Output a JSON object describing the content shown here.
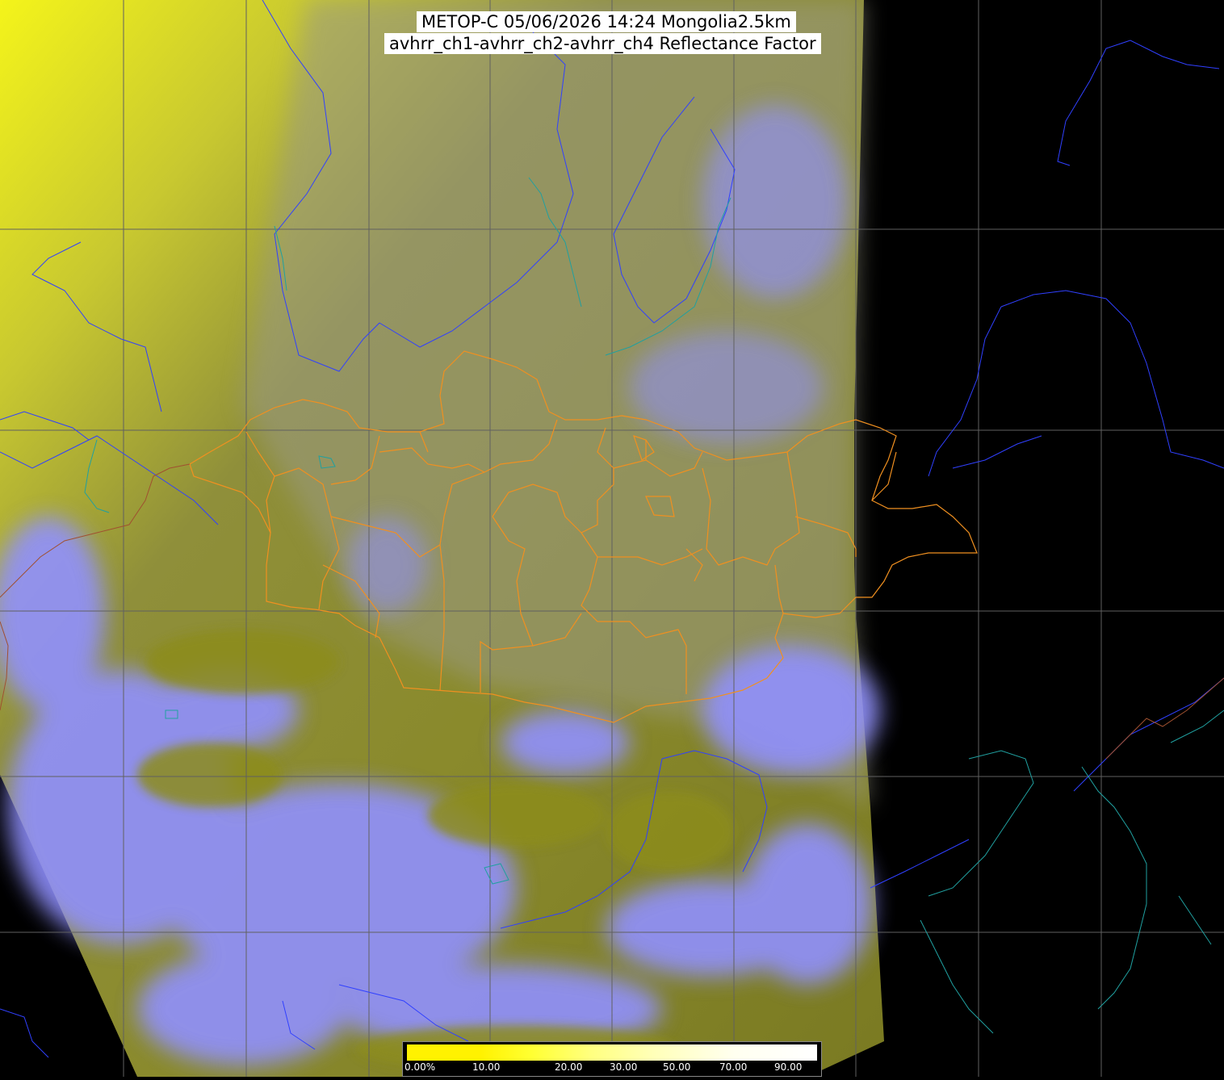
{
  "title": {
    "line1": "METOP-C 05/06/2026 14:24 Mongolia2.5km",
    "line2": "avhrr_ch1-avhrr_ch2-avhrr_ch4 Reflectance Factor"
  },
  "colorbar": {
    "labels": [
      "0.00%",
      "10.00",
      "20.00",
      "30.00",
      "50.00",
      "70.00",
      "90.00"
    ]
  },
  "colors": {
    "background": "#000000",
    "land_olive": "#8a8a2a",
    "cloud": "#9090ff",
    "desert_yellow": "#f0f020",
    "border_orange": "#f09020",
    "coast_blue": "#3040ff",
    "coast_teal": "#20a0a0",
    "grid": "#606060"
  }
}
